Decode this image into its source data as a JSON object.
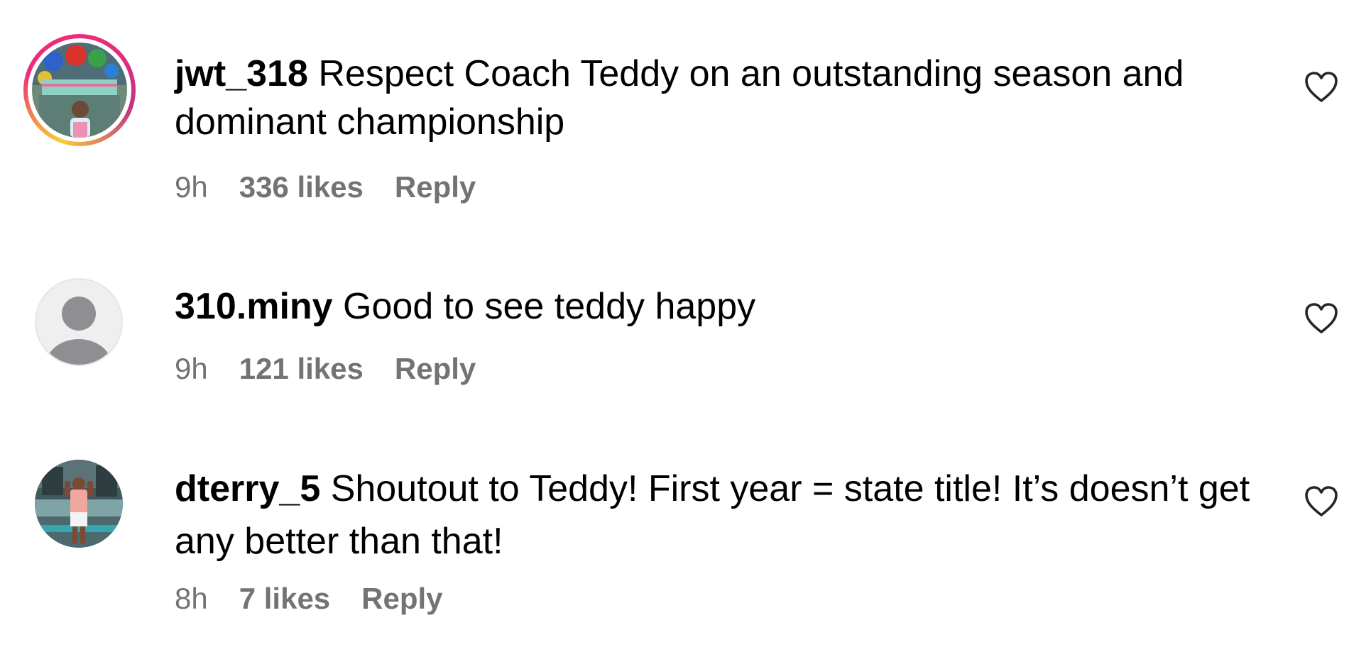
{
  "comments": [
    {
      "username": "jwt_318",
      "text": "Respect Coach Teddy on an outstanding season and dominant championship",
      "time": "9h",
      "likes": "336 likes",
      "reply": "Reply",
      "avatar": "photo-story-ring",
      "like_icon": "heart-outline-icon"
    },
    {
      "username": "310.miny",
      "text": "Good to see teddy happy",
      "time": "9h",
      "likes": "121 likes",
      "reply": "Reply",
      "avatar": "default-avatar-icon",
      "like_icon": "heart-outline-icon"
    },
    {
      "username": "dterry_5",
      "text": "Shoutout to Teddy! First year = state title! It’s doesn’t get any better than that!",
      "time": "8h",
      "likes": "7 likes",
      "reply": "Reply",
      "avatar": "photo",
      "like_icon": "heart-outline-icon"
    }
  ],
  "colors": {
    "text": "#000000",
    "meta": "#737373",
    "ring_start": "#f9ce34",
    "ring_end": "#ee2a7b",
    "default_avatar_bg": "#efefef",
    "default_avatar_fg": "#8e8e93"
  }
}
